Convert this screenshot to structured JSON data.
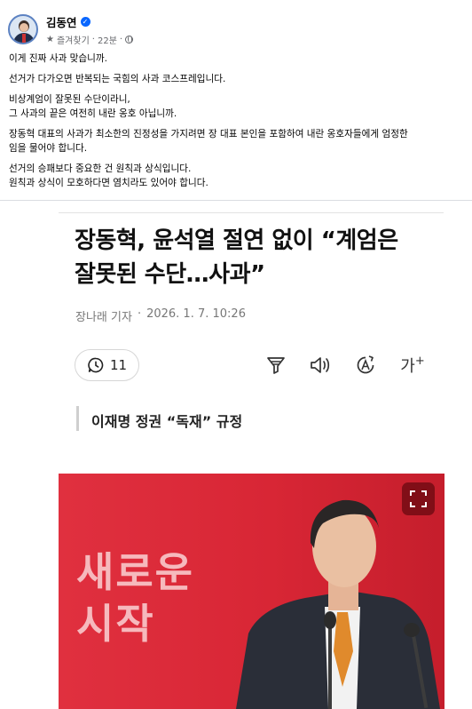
{
  "post": {
    "author_name": "김동연",
    "meta_favorites": "즐겨찾기",
    "meta_time": "22분",
    "meta_separator": "·",
    "paragraphs": [
      [
        "이게 진짜 사과 맞습니까."
      ],
      [
        "선거가 다가오면 반복되는 국힘의 사과 코스프레입니다."
      ],
      [
        "비상계엄이 잘못된 수단이라니,",
        "그 사과의 끝은 여전히 내란 옹호 아닙니까."
      ],
      [
        "장동혁 대표의 사과가 최소한의 진정성을 가지려면 장 대표 본인을 포함하여 내란 옹호자들에게 엄정한",
        "임을 물어야 합니다."
      ],
      [
        "선거의 승패보다 중요한 건 원칙과 상식입니다.",
        "원칙과 상식이 모호하다면 염치라도 있어야 합니다."
      ]
    ]
  },
  "article": {
    "headline_line1": "장동혁, 윤석열 절연 없이 “계엄은",
    "headline_line2": "잘못된 수단…사과”",
    "reporter": "장나래 기자",
    "dot": "·",
    "date": "2026. 1. 7. 10:26",
    "comment_count": "11",
    "font_size_icon_label": "가",
    "subheading": "이재명 정권 “독재” 규정",
    "photo_slogan_line1": "새로운",
    "photo_slogan_line2": "시작"
  },
  "icons": {
    "verified": "verified-badge-icon",
    "favorites": "star-icon",
    "privacy": "globe-icon",
    "comment": "comment-icon",
    "summary": "filter-icon",
    "listen": "speaker-icon",
    "translate": "translate-icon",
    "text_size": "text-size-icon",
    "expand": "expand-icon"
  },
  "colors": {
    "fb_blue": "#0866ff",
    "photo_red": "#d82635",
    "secondary_text": "#65676b"
  }
}
